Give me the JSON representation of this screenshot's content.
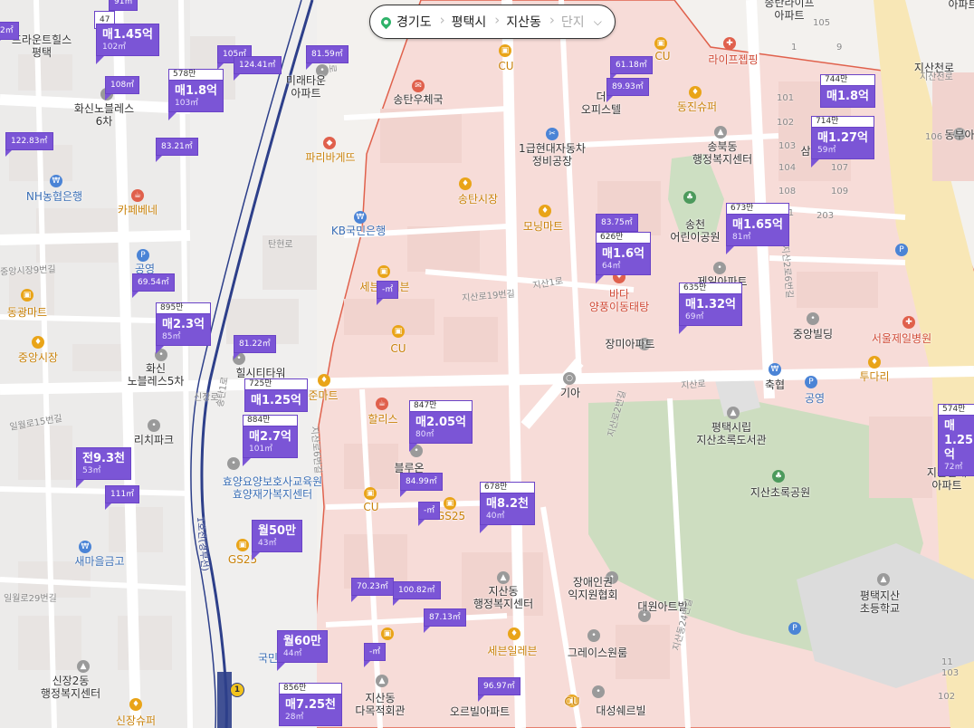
{
  "breadcrumb": {
    "items": [
      "경기도",
      "평택시",
      "지산동"
    ],
    "extra": "단지",
    "chevron_icon": "chevron-down-icon",
    "pin_icon": "location-pin-icon"
  },
  "labels": {
    "l1": "프라운트힐스\n평택",
    "l2": "화신노블레스\n6차",
    "l3": "NH농협은행",
    "l4": "카페베네",
    "l5": "공영",
    "l6": "동광마트",
    "l7": "중앙시장",
    "l8": "화신\n노블레스5차",
    "l9": "힐시티타워",
    "l10": "리치파크",
    "l11": "새마을금고",
    "l12": "신장2동\n행정복지센터",
    "l13": "신장슈퍼",
    "l14": "효양요양보호사교육원\n효양재가복지센터",
    "l15": "국민",
    "l16": "미래타운\n아파트",
    "l17": "파리바게뜨",
    "l18": "송탄우체국",
    "l19": "송탄시장",
    "l20": "KB국민은행",
    "l21": "세븐일레븐",
    "l22": "CU",
    "l23": "준마트",
    "l24": "할리스",
    "l25": "블루온",
    "l26": "GS25",
    "l27": "지산동\n행정복지센터",
    "l28": "세븐일레븐",
    "l29": "지산동\n다목적회관",
    "l30": "오르빌아파트",
    "l31": "CU",
    "l32": "1급현대자동차\n정비공장",
    "l33": "모닝마트",
    "l34": "양풍이동태탕",
    "l35": "기아",
    "l36": "장애인권\n익지원협회",
    "l37": "대원아트빌",
    "l38": "그레이스원룸",
    "l39": "대성쉐르빌",
    "l40": "동진슈퍼",
    "l41": "송북동\n행정복지센터",
    "l42": "송천\n어린이공원",
    "l43": "제일아파트",
    "l44": "장미아파트",
    "l45": "중앙빌딩",
    "l46": "축협",
    "l47": "공영",
    "l48": "평택시립\n지산초록도서관",
    "l49": "지산초록공원",
    "l50": "서울제일병원",
    "l51": "투다리",
    "l52": "평택지산\n초등학교",
    "l53": "지산현대\n아파트",
    "l54": "라이프젭핑",
    "l55": "동부아",
    "l56": "CU",
    "l57": "CU",
    "l58": "CU",
    "l59": "GS25",
    "l60": "송탄라이프\n아파트",
    "l61": "지산천로",
    "l62": "더\n오피스텔",
    "l63": "바다",
    "l64": "삼",
    "l65": "아파트"
  },
  "roads": {
    "r1": "지산로19번길",
    "r2": "지산1로",
    "r3": "지산로",
    "r4": "신장로",
    "r5": "탄현로",
    "r6": "중앙시장9번길",
    "r7": "일월로15번길",
    "r8": "일월로29번길",
    "r9": "송탄1로",
    "r10": "1호선(경부선)",
    "r11": "지산로6번길",
    "r12": "지산로2번길",
    "r13": "지산동24번길",
    "r14": "지산2로6번길",
    "r15": "지산천로",
    "r16": "탄현로"
  },
  "markers": [
    {
      "top": "",
      "price": "매1.45억",
      "area": "102㎡"
    },
    {
      "top": "578만",
      "price": "매1.8억",
      "area": "103㎡"
    },
    {
      "top": "895만",
      "price": "매2.3억",
      "area": "85㎡"
    },
    {
      "top": "",
      "price": "전9.3천",
      "area": "53㎡"
    },
    {
      "top": "725만",
      "price": "매1.25억",
      "area": ""
    },
    {
      "top": "884만",
      "price": "매2.7억",
      "area": "101㎡"
    },
    {
      "top": "",
      "price": "월50만",
      "area": "43㎡"
    },
    {
      "top": "",
      "price": "월60만",
      "area": "44㎡"
    },
    {
      "top": "856만",
      "price": "매7.25천",
      "area": "28㎡"
    },
    {
      "top": "847만",
      "price": "매2.05억",
      "area": "80㎡"
    },
    {
      "top": "678만",
      "price": "매8.2천",
      "area": "40㎡"
    },
    {
      "top": "626만",
      "price": "매1.6억",
      "area": "64㎡"
    },
    {
      "top": "673만",
      "price": "매1.65억",
      "area": "81㎡"
    },
    {
      "top": "635만",
      "price": "매1.32억",
      "area": "69㎡"
    },
    {
      "top": "744만",
      "price": "매1.8억",
      "area": ""
    },
    {
      "top": "714만",
      "price": "매1.27억",
      "area": "59㎡"
    },
    {
      "top": "574만",
      "price": "매1.25억",
      "area": "72㎡"
    }
  ],
  "small_markers": [
    "91㎡",
    "105㎡",
    "124.41㎡",
    "81.59㎡",
    "108㎡",
    "122.83㎡",
    "83.21㎡",
    "69.54㎡",
    "81.22㎡",
    "111㎡",
    "-㎡",
    "84.99㎡",
    "-㎡",
    "70.23㎡",
    "100.82㎡",
    "87.13㎡",
    "-㎡",
    "96.97㎡",
    "83.75㎡",
    "61.18㎡",
    "89.93㎡",
    "2㎡",
    "47"
  ],
  "street_numbers": [
    "101",
    "102",
    "103",
    "104",
    "106",
    "107",
    "108",
    "109",
    "201",
    "203",
    "105",
    "9",
    "1",
    "11",
    "102",
    "103"
  ],
  "subway_badge": "1"
}
